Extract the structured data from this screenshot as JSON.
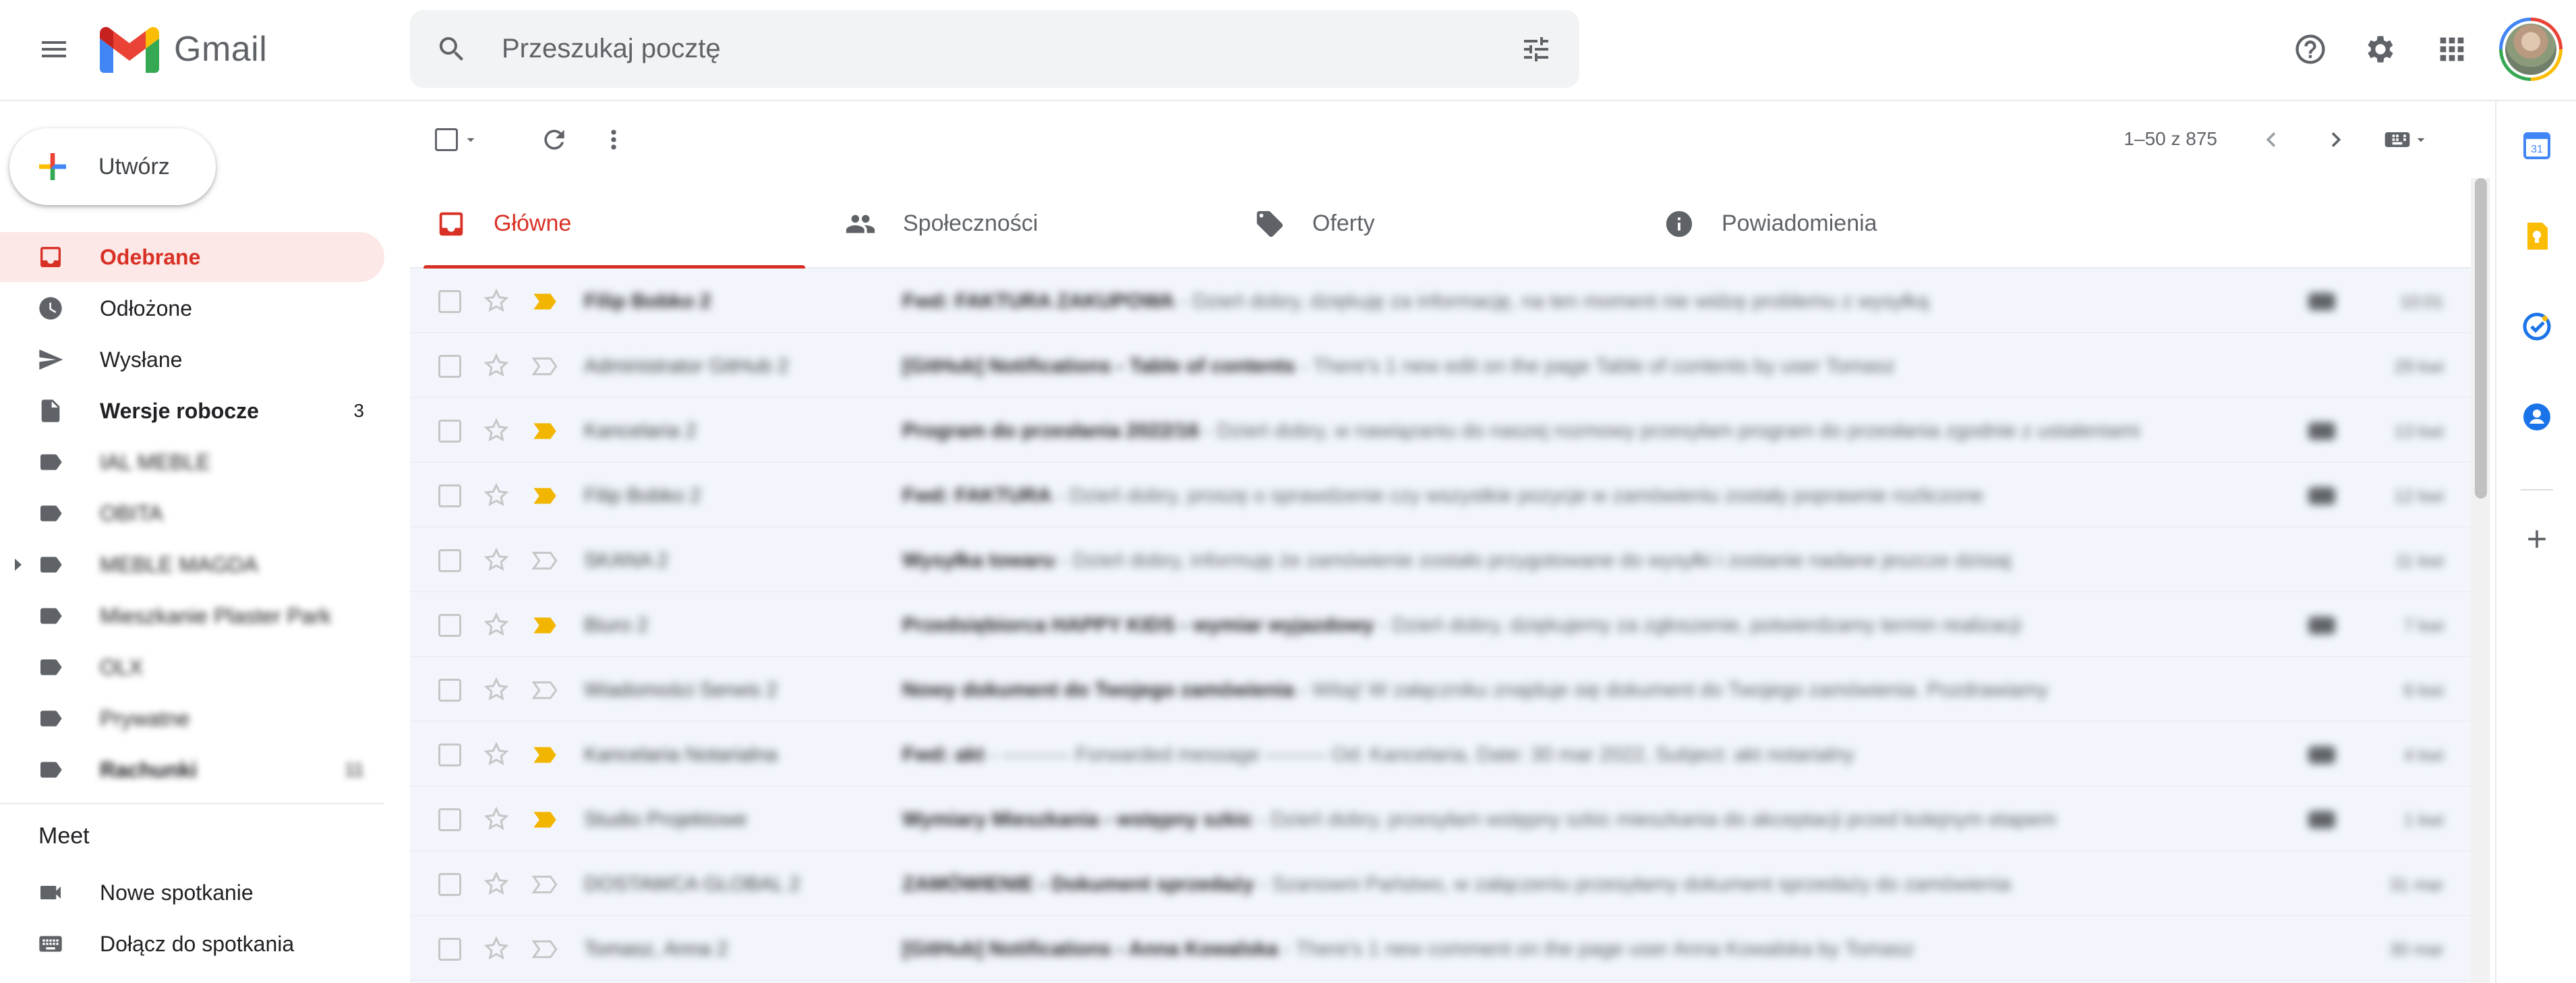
{
  "header": {
    "app_name": "Gmail",
    "search_placeholder": "Przeszukaj pocztę"
  },
  "compose": {
    "label": "Utwórz"
  },
  "nav": {
    "items": [
      {
        "label": "Odebrane",
        "count": ""
      },
      {
        "label": "Odłożone",
        "count": ""
      },
      {
        "label": "Wysłane",
        "count": ""
      },
      {
        "label": "Wersje robocze",
        "count": "3"
      },
      {
        "label": "IAL MEBLE",
        "count": ""
      },
      {
        "label": "OBITA",
        "count": ""
      },
      {
        "label": "MEBLE MAGDA",
        "count": ""
      },
      {
        "label": "Mieszkanie Plaster Park",
        "count": ""
      },
      {
        "label": "OLX",
        "count": ""
      },
      {
        "label": "Prywatne",
        "count": ""
      },
      {
        "label": "Rachunki",
        "count": "11"
      }
    ],
    "meet_title": "Meet",
    "meet_items": [
      {
        "label": "Nowe spotkanie"
      },
      {
        "label": "Dołącz do spotkania"
      }
    ]
  },
  "toolbar": {
    "pager": "1–50 z 875"
  },
  "tabs": [
    {
      "label": "Główne",
      "icon": "inbox-icon"
    },
    {
      "label": "Społeczności",
      "icon": "people-icon"
    },
    {
      "label": "Oferty",
      "icon": "tag-icon"
    },
    {
      "label": "Powiadomienia",
      "icon": "info-icon"
    }
  ],
  "emails": [
    {
      "sender": "Filip Bobko 2",
      "subject": "Fwd: FAKTURA ZAKUPOWA",
      "preview": " - Dzień dobry, dziękuję za informację, na ten moment nie widzę problemu z wysyłką",
      "date": "10:01",
      "important": true,
      "bold": true
    },
    {
      "sender": "Administrator GitHub 2",
      "subject": "[GitHub] Notifications - Table of contents",
      "preview": " - There's 1 new edit on the page Table of contents by user Tomasz",
      "date": "29 kwi",
      "important": false,
      "bold": false
    },
    {
      "sender": "Kancelaria 2",
      "subject": "Program do przesłania 2022/16",
      "preview": " - Dzień dobry, w nawiązaniu do naszej rozmowy przesyłam program do przesłania zgodnie z ustaleniami",
      "date": "13 kwi",
      "important": true,
      "bold": false
    },
    {
      "sender": "Filip Bobko 2",
      "subject": "Fwd: FAKTURA",
      "preview": " - Dzień dobry, proszę o sprawdzenie czy wszystkie pozycje w zamówieniu zostały poprawnie rozliczone",
      "date": "12 kwi",
      "important": true,
      "bold": false
    },
    {
      "sender": "SKANA 2",
      "subject": "Wysyłka towaru",
      "preview": " - Dzień dobry, informuję że zamówienie zostało przygotowane do wysyłki i zostanie nadane jeszcze dzisiaj",
      "date": "11 kwi",
      "important": false,
      "bold": false
    },
    {
      "sender": "Biuro 2",
      "subject": "Przedsiębiorca HAPPY KIDS - wymiar wyjazdowy",
      "preview": " - Dzień dobry, dziękujemy za zgłoszenie, potwierdzamy termin realizacji",
      "date": "7 kwi",
      "important": true,
      "bold": false
    },
    {
      "sender": "Wiadomości Serwis 2",
      "subject": "Nowy dokument do Twojego zamówienia",
      "preview": " - Witaj! W załączniku znajduje się dokument do Twojego zamówienia. Pozdrawiamy",
      "date": "6 kwi",
      "important": false,
      "bold": false
    },
    {
      "sender": "Kancelaria Notarialna",
      "subject": "Fwd: akt",
      "preview": " - ---------- Forwarded message --------- Od: Kancelaria, Date: 30 mar 2022, Subject: akt notarialny",
      "date": "4 kwi",
      "important": true,
      "bold": false
    },
    {
      "sender": "Studio Projektowe",
      "subject": "Wymiary Mieszkania - wstępny szkic",
      "preview": " - Dzień dobry, przesyłam wstępny szkic mieszkania do akceptacji przed kolejnym etapem",
      "date": "1 kwi",
      "important": true,
      "bold": false
    },
    {
      "sender": "DOSTAWCA GLOBAL 2",
      "subject": "ZAMÓWIENIE - Dokument sprzedaży",
      "preview": " - Szanowni Państwo, w załączeniu przesyłamy dokument sprzedaży do zamówienia",
      "date": "31 mar",
      "important": false,
      "bold": false
    },
    {
      "sender": "Tomasz, Anna 2",
      "subject": "[GitHub] Notifications - Anna Kowalska",
      "preview": " - There's 1 new comment on the page user Anna Kowalska by Tomasz",
      "date": "30 mar",
      "important": false,
      "bold": false
    }
  ],
  "colors": {
    "accent": "#d93025",
    "active_bg": "#fce8e6",
    "important": "#f2b600",
    "list_bg": "#f2f6fc"
  }
}
